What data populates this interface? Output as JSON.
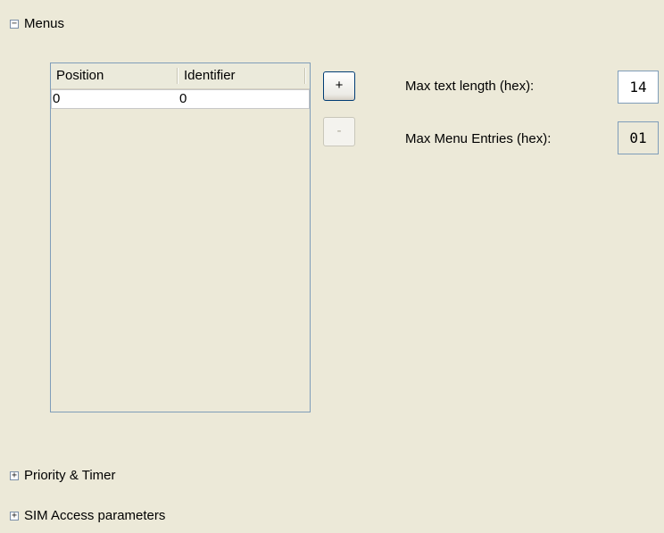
{
  "sections": {
    "menus": {
      "label": "Menus",
      "toggle": "−"
    },
    "priority_timer": {
      "label": "Priority & Timer",
      "toggle": "+"
    },
    "sim_access": {
      "label": "SIM Access parameters",
      "toggle": "+"
    }
  },
  "table": {
    "columns": [
      "Position",
      "Identifier"
    ],
    "rows": [
      [
        "0",
        "0"
      ]
    ]
  },
  "buttons": {
    "add_label": "+",
    "remove_label": "-"
  },
  "fields": {
    "max_text_length": {
      "label": "Max text length (hex):",
      "value": "14"
    },
    "max_menu_entries": {
      "label": "Max Menu Entries (hex):",
      "value": "01"
    }
  }
}
